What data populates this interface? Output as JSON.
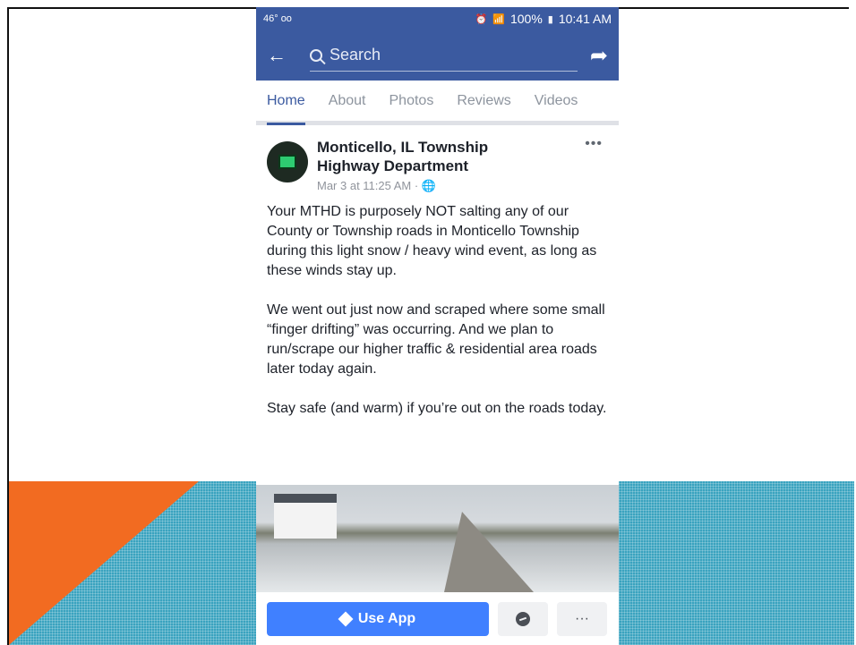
{
  "status_bar": {
    "left_text": "46° ᴏᴏ",
    "battery": "100%",
    "time": "10:41 AM"
  },
  "search": {
    "placeholder": "Search"
  },
  "tabs": [
    {
      "label": "Home",
      "active": true
    },
    {
      "label": "About",
      "active": false
    },
    {
      "label": "Photos",
      "active": false
    },
    {
      "label": "Reviews",
      "active": false
    },
    {
      "label": "Videos",
      "active": false
    }
  ],
  "post": {
    "page_name": "Monticello, IL Township Highway Department",
    "timestamp": "Mar 3 at 11:25 AM · 🌐",
    "paragraphs": [
      "Your MTHD is purposely NOT salting any of our County or Township roads in Monticello Township during this light snow / heavy wind event, as long as these winds stay up.",
      "We went out just now and scraped where some small “finger drifting” was occurring. And we plan to run/scrape our higher traffic & residential area roads later today again.",
      "Stay safe (and warm) if you’re out on the roads today."
    ]
  },
  "actions": {
    "use_app_label": "Use App",
    "more_label": "···"
  },
  "colors": {
    "brand_blue": "#3b5aa0",
    "button_blue": "#4080ff",
    "slide_orange": "#f26b21",
    "slide_teal": "#3aa3bf"
  }
}
